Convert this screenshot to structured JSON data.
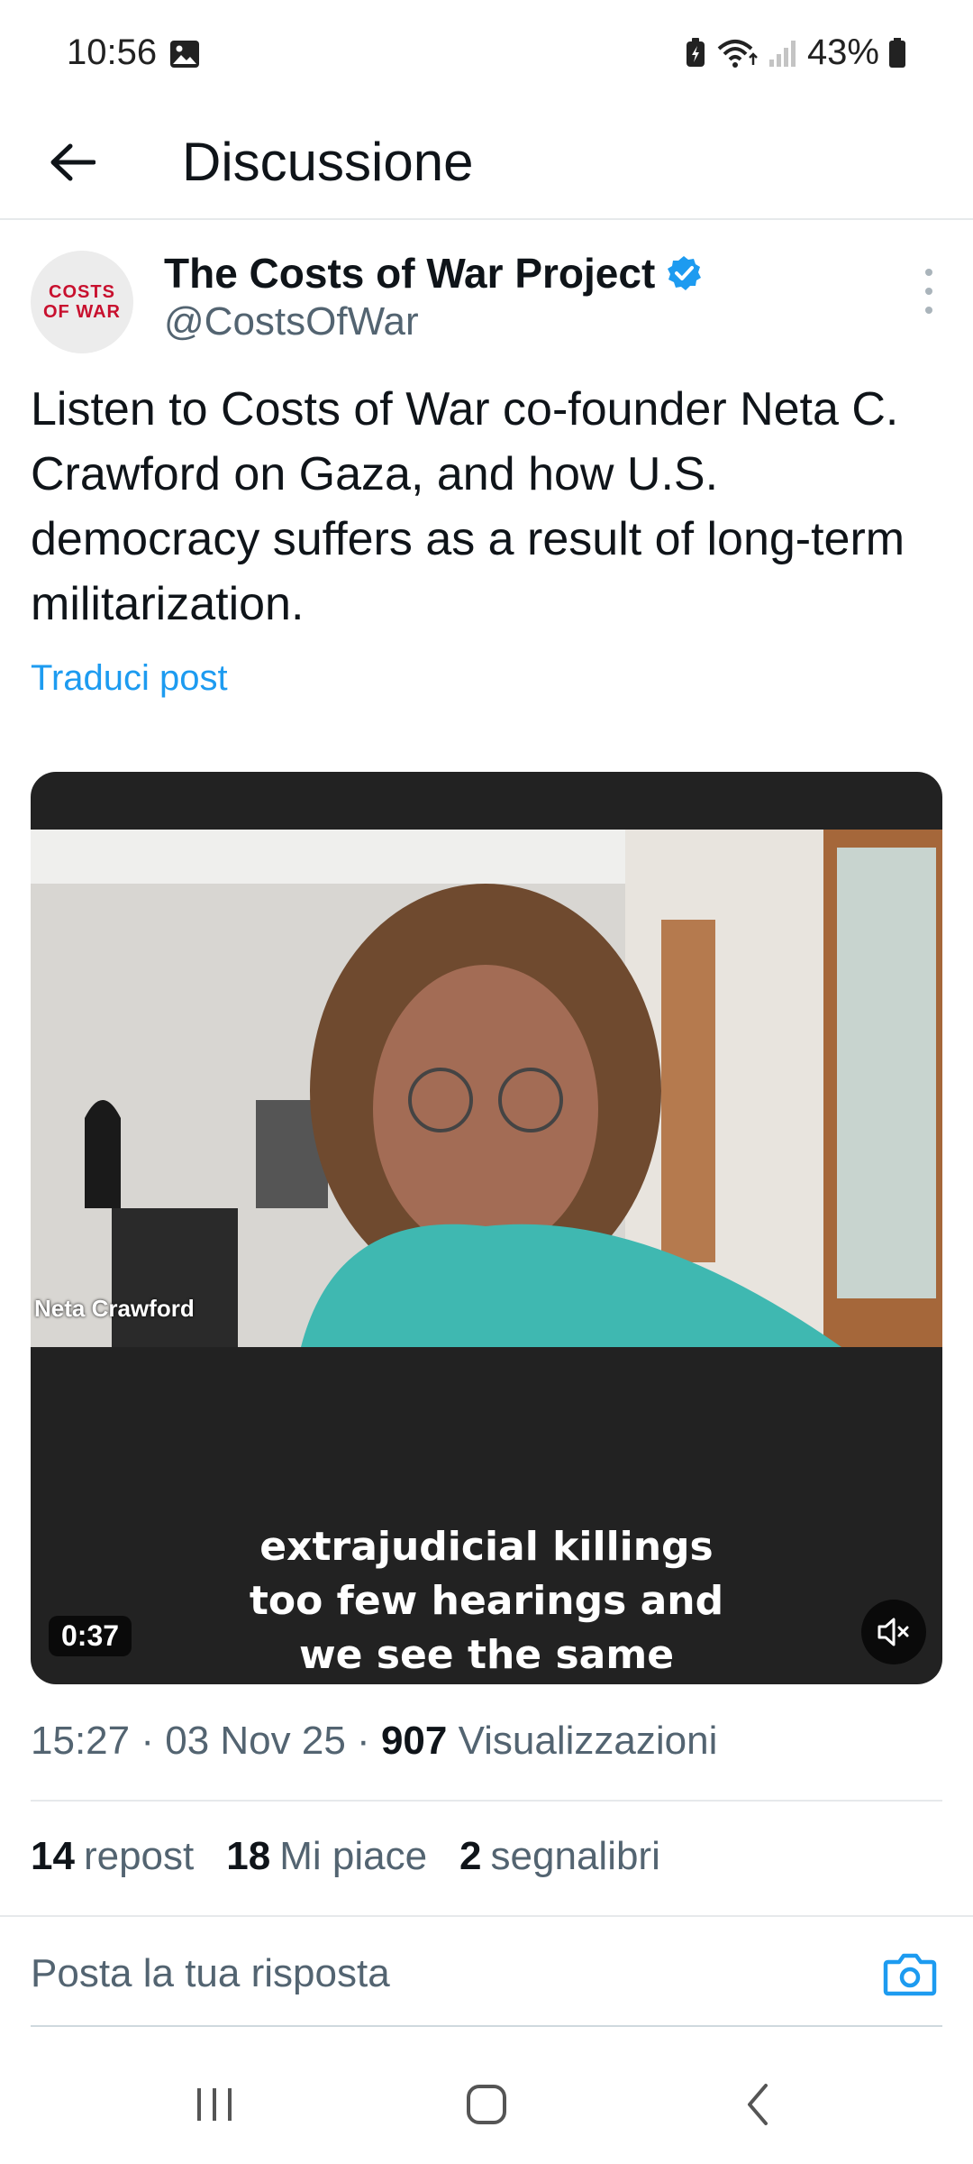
{
  "status_bar": {
    "time": "10:56",
    "battery": "43%",
    "icons": [
      "image-icon",
      "battery-saver-icon",
      "wifi-icon",
      "signal-icon",
      "battery-icon"
    ]
  },
  "header": {
    "title": "Discussione",
    "back_icon": "arrow-left-icon"
  },
  "author": {
    "name": "The Costs of War Project",
    "handle": "@CostsOfWar",
    "verified": true,
    "avatar_text_line1": "COSTS",
    "avatar_text_line2": "OF WAR"
  },
  "post": {
    "text": "Listen to Costs of War co-founder Neta C. Crawford on Gaza, and how U.S. democracy suffers as a result of long-term militarization.",
    "translate_label": "Traduci post"
  },
  "video": {
    "name_tag": "Neta Crawford",
    "caption_lines": [
      "extrajudicial killings",
      "too few hearings and",
      "we see the same"
    ],
    "duration": "0:37",
    "muted": true
  },
  "meta": {
    "time": "15:27",
    "date": "03 Nov 25",
    "views": "907",
    "views_label": "Visualizzazioni"
  },
  "stats": {
    "reposts": "14",
    "reposts_label": "repost",
    "likes": "18",
    "likes_label": "Mi piace",
    "bookmarks": "2",
    "bookmarks_label": "segnalibri"
  },
  "reply": {
    "placeholder": "Posta la tua risposta"
  },
  "colors": {
    "accent": "#1d9bf0",
    "text": "#0f1419",
    "secondary": "#536471",
    "video_bg": "#222222"
  }
}
